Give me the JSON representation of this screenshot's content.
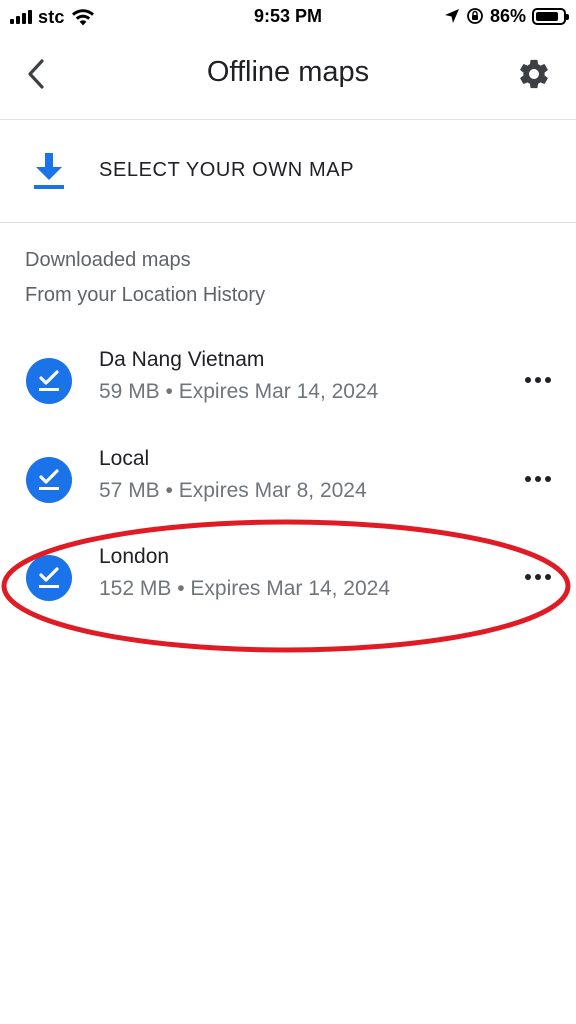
{
  "status_bar": {
    "carrier": "stc",
    "time": "9:53 PM",
    "battery_percent": "86%",
    "battery_level": 0.86
  },
  "header": {
    "title": "Offline maps",
    "back_icon": "chevron-left-icon",
    "settings_icon": "gear-icon"
  },
  "select_own_map": {
    "label": "SELECT YOUR OWN MAP",
    "icon": "download-icon",
    "accent": "#1a73e8"
  },
  "section": {
    "title": "Downloaded maps",
    "subtitle": "From your Location History"
  },
  "maps": [
    {
      "name": "Da Nang Vietnam",
      "size": "59 MB",
      "expires": "Expires Mar 14, 2024"
    },
    {
      "name": "Local",
      "size": "57 MB",
      "expires": "Expires Mar 8, 2024"
    },
    {
      "name": "London",
      "size": "152 MB",
      "expires": "Expires Mar 14, 2024"
    }
  ],
  "annotation": {
    "color": "#e01b24",
    "target": "London"
  }
}
